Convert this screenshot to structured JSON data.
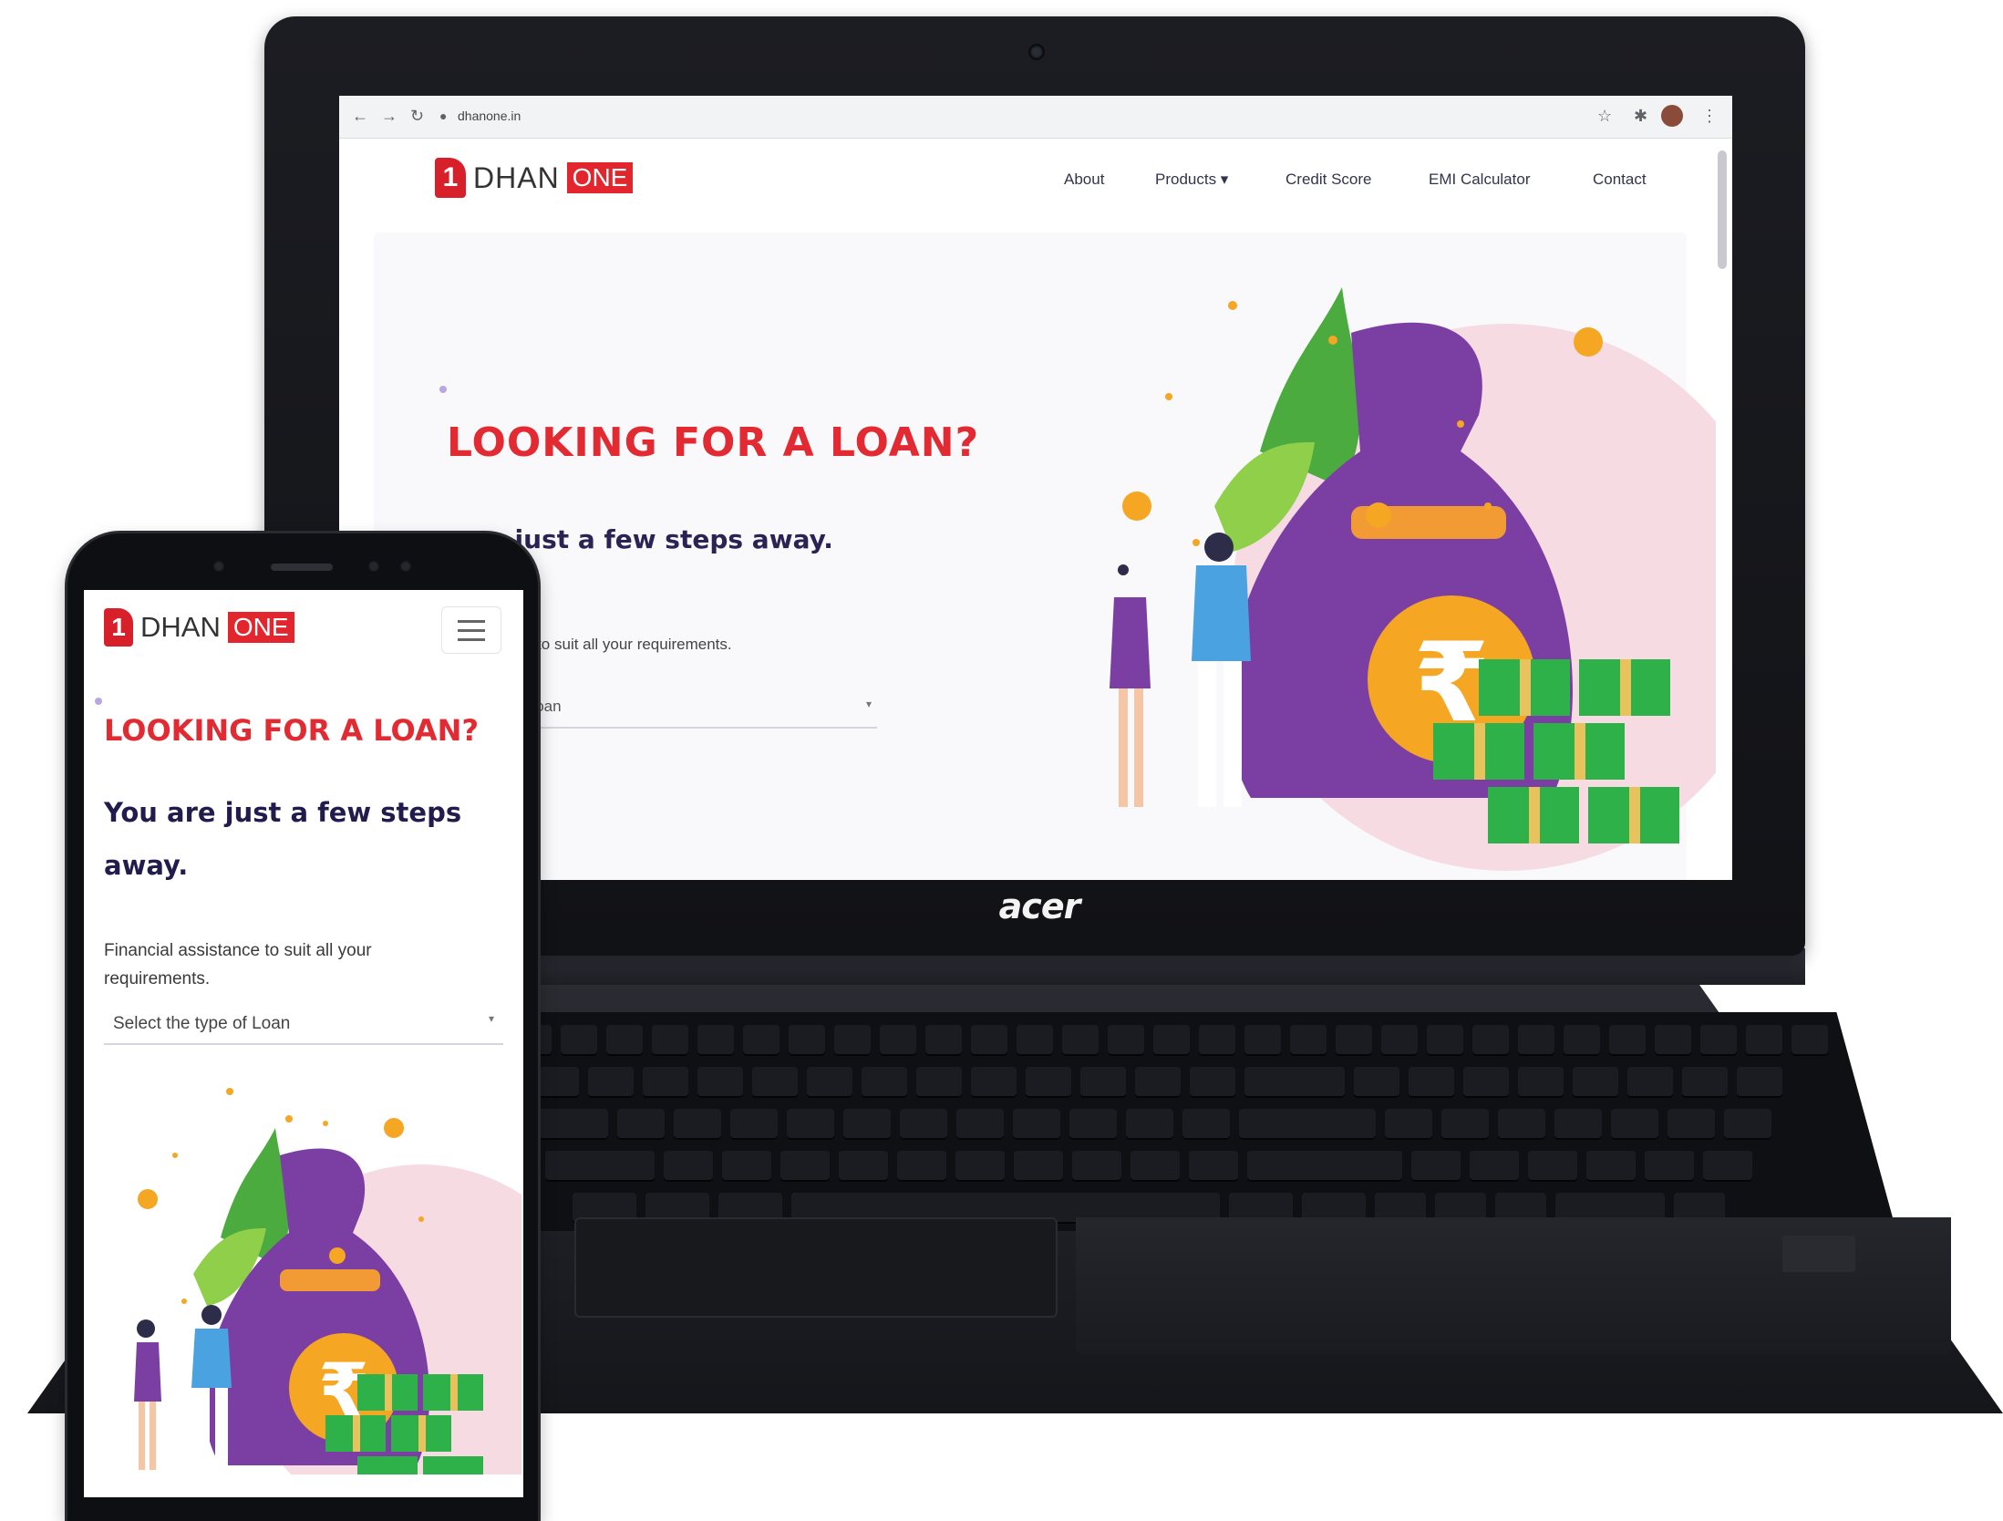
{
  "laptop": {
    "brand": "acer",
    "browser": {
      "url": "dhanone.in",
      "back_icon": "arrow-left-icon",
      "forward_icon": "arrow-right-icon",
      "reload_icon": "reload-icon",
      "lock_icon": "lock-icon",
      "star_icon": "star-icon",
      "extension_icon": "puzzle-icon",
      "profile_icon": "avatar-icon",
      "menu_icon": "kebab-menu-icon"
    },
    "site": {
      "logo_mark": "1",
      "logo_text": "DHAN",
      "logo_badge": "ONE",
      "nav": [
        "About",
        "Products ▾",
        "Credit Score",
        "EMI Calculator",
        "Contact"
      ],
      "hero_title": "LOOKING FOR A LOAN?",
      "hero_subtitle": "re just a few steps away.",
      "hero_desc": "sistance to suit all your requirements.",
      "select_placeholder": "type of Loan",
      "select_caret": "▾"
    }
  },
  "phone": {
    "site": {
      "logo_mark": "1",
      "logo_text": "DHAN",
      "logo_badge": "ONE",
      "menu_icon": "hamburger-icon",
      "hero_title": "LOOKING FOR A LOAN?",
      "hero_subtitle": "You are just a few steps away.",
      "hero_desc": "Financial assistance to suit all your requirements.",
      "select_placeholder": "Select the type of Loan",
      "select_caret": "▾"
    }
  },
  "illustration": {
    "rupee_symbol": "₹",
    "coin_symbol": "₹",
    "colors": {
      "brand_red": "#e3262e",
      "bag_purple": "#7b3fa3",
      "coin_orange": "#f5a623",
      "cash_green": "#2fb14a",
      "blob_pink": "#f7dbe3"
    }
  }
}
